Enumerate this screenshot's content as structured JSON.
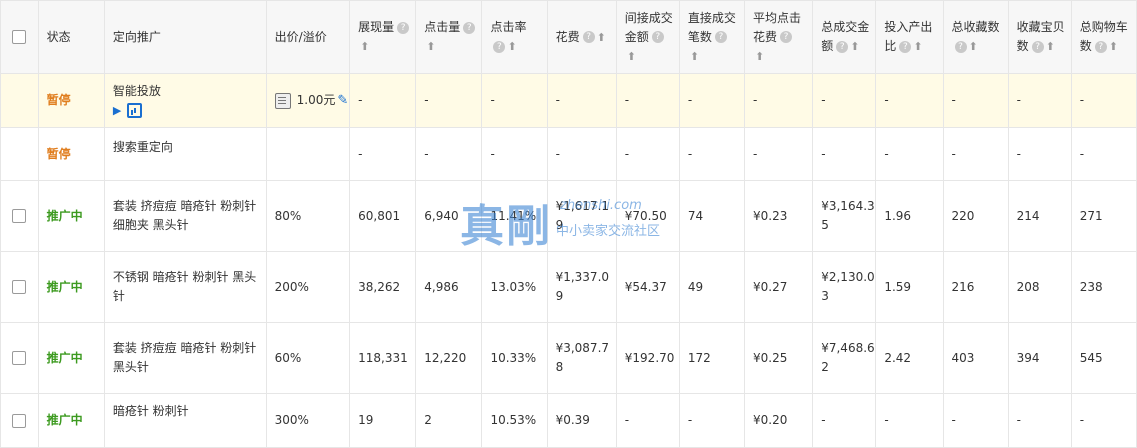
{
  "headers": {
    "status": "状态",
    "target": "定向推广",
    "bid": "出价/溢价",
    "impressions": "展现量",
    "clicks": "点击量",
    "ctr": "点击率",
    "cost": "花费",
    "indirect_amount": "间接成交金额",
    "direct_count": "直接成交笔数",
    "avg_click_cost": "平均点击花费",
    "total_amount": "总成交金额",
    "roi": "投入产出比",
    "total_fav": "总收藏数",
    "fav_items": "收藏宝贝数",
    "total_cart": "总购物车数"
  },
  "icons": {
    "help": "?",
    "sort": "⬆",
    "play": "▶",
    "pencil": "✎"
  },
  "rows": [
    {
      "status": "暂停",
      "target": "智能投放",
      "bid": "1.00元",
      "impressions": "-",
      "clicks": "-",
      "ctr": "-",
      "cost": "-",
      "indirect_amount": "-",
      "direct_count": "-",
      "avg_click_cost": "-",
      "total_amount": "-",
      "roi": "-",
      "total_fav": "-",
      "fav_items": "-",
      "total_cart": "-"
    },
    {
      "status": "暂停",
      "target": "搜索重定向",
      "bid": "",
      "impressions": "-",
      "clicks": "-",
      "ctr": "-",
      "cost": "-",
      "indirect_amount": "-",
      "direct_count": "-",
      "avg_click_cost": "-",
      "total_amount": "-",
      "roi": "-",
      "total_fav": "-",
      "fav_items": "-",
      "total_cart": "-"
    },
    {
      "status": "推广中",
      "target": "套装 挤痘痘 暗疮针 粉刺针 细胞夹 黑头针",
      "bid": "80%",
      "impressions": "60,801",
      "clicks": "6,940",
      "ctr": "11.41%",
      "cost": "¥1,617.19",
      "indirect_amount": "¥70.50",
      "direct_count": "74",
      "avg_click_cost": "¥0.23",
      "total_amount": "¥3,164.35",
      "roi": "1.96",
      "total_fav": "220",
      "fav_items": "214",
      "total_cart": "271"
    },
    {
      "status": "推广中",
      "target": "不锈钢 暗疮针 粉刺针 黑头针",
      "bid": "200%",
      "impressions": "38,262",
      "clicks": "4,986",
      "ctr": "13.03%",
      "cost": "¥1,337.09",
      "indirect_amount": "¥54.37",
      "direct_count": "49",
      "avg_click_cost": "¥0.27",
      "total_amount": "¥2,130.03",
      "roi": "1.59",
      "total_fav": "216",
      "fav_items": "208",
      "total_cart": "238"
    },
    {
      "status": "推广中",
      "target": "套装 挤痘痘 暗疮针 粉刺针 黑头针",
      "bid": "60%",
      "impressions": "118,331",
      "clicks": "12,220",
      "ctr": "10.33%",
      "cost": "¥3,087.78",
      "indirect_amount": "¥192.70",
      "direct_count": "172",
      "avg_click_cost": "¥0.25",
      "total_amount": "¥7,468.62",
      "roi": "2.42",
      "total_fav": "403",
      "fav_items": "394",
      "total_cart": "545"
    },
    {
      "status": "推广中",
      "target": "暗疮针 粉刺针",
      "bid": "300%",
      "impressions": "19",
      "clicks": "2",
      "ctr": "10.53%",
      "cost": "¥0.39",
      "indirect_amount": "-",
      "direct_count": "-",
      "avg_click_cost": "¥0.20",
      "total_amount": "-",
      "roi": "-",
      "total_fav": "-",
      "fav_items": "-",
      "total_cart": "-"
    }
  ],
  "watermark": {
    "big": "真剛",
    "url": "zhenshi.com",
    "sub": "中小卖家交流社区"
  }
}
